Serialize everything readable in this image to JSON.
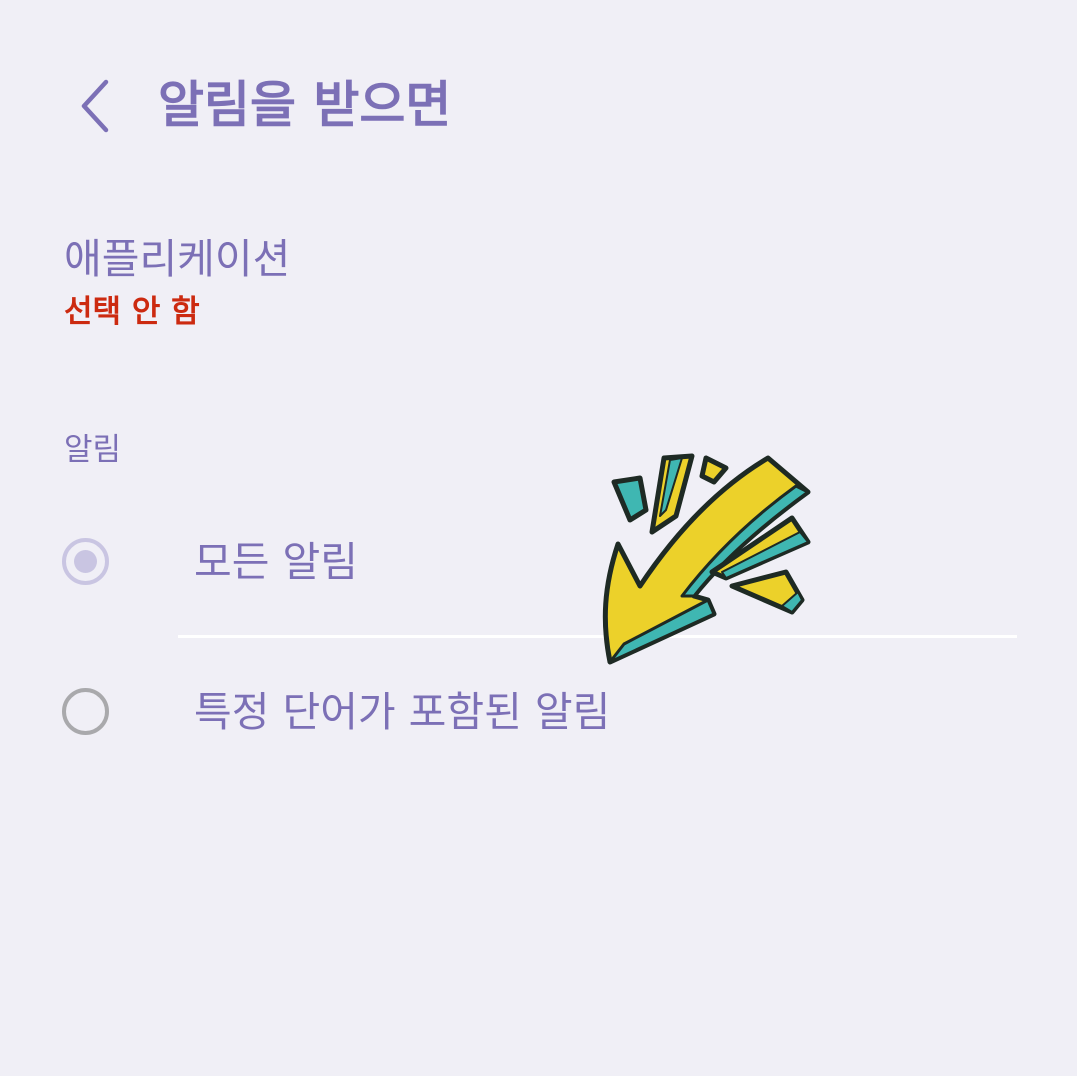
{
  "header": {
    "title": "알림을 받으면",
    "back_icon": "chevron-left-icon"
  },
  "application": {
    "title": "애플리케이션",
    "value": "선택 안 함"
  },
  "notifications": {
    "section_label": "알림",
    "options": [
      {
        "label": "모든 알림",
        "selected": true
      },
      {
        "label": "특정 단어가 포함된 알림",
        "selected": false
      }
    ]
  },
  "decoration": {
    "icon": "hand-drawn-arrow-icon"
  },
  "colors": {
    "background": "#f0eff6",
    "accent": "#7c70b6",
    "warning": "#cc2a10",
    "radio_selected": "#c9c5e2",
    "radio_unselected": "#a9a9ac",
    "arrow_yellow": "#ecd12a",
    "arrow_teal": "#3fb7b2"
  }
}
